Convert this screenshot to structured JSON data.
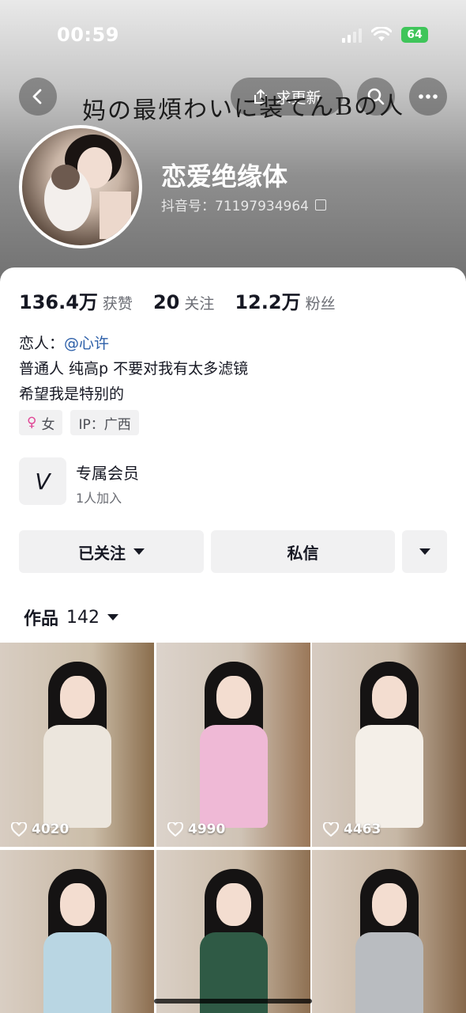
{
  "status_bar": {
    "time": "00:59",
    "battery": "64"
  },
  "header": {
    "update_label": "求更新",
    "handwriting": "妈の最煩わいに装てんBの人",
    "username": "恋爱绝缘体",
    "douyin_id": "抖音号：71197934964"
  },
  "stats": [
    {
      "value": "136.4万",
      "label": "获赞"
    },
    {
      "value": "20",
      "label": "关注"
    },
    {
      "value": "12.2万",
      "label": "粉丝"
    }
  ],
  "bio": {
    "lover_prefix": "恋人：",
    "lover_mention": "@心许",
    "line2": "普通人 纯高p 不要对我有太多滤镜",
    "line3": "希望我是特别的"
  },
  "tags": {
    "gender": "女",
    "ip": "IP：广西"
  },
  "member": {
    "title": "专属会员",
    "subtitle": "1人加入",
    "logo": "V"
  },
  "actions": {
    "following": "已关注",
    "message": "私信"
  },
  "works": {
    "label": "作品",
    "count": "142"
  },
  "grid": [
    {
      "likes": "4020"
    },
    {
      "likes": "4990"
    },
    {
      "likes": "4463"
    },
    {
      "likes": ""
    },
    {
      "likes": ""
    },
    {
      "likes": ""
    }
  ],
  "colors": {
    "mention": "#2b5ea8",
    "female": "#e04796",
    "battery": "#3fc55a",
    "button_bg": "#f1f1f2"
  },
  "icons": [
    "back-icon",
    "share-icon",
    "search-icon",
    "more-icon",
    "copy-icon",
    "female-icon",
    "heart-icon",
    "chevron-down-icon"
  ]
}
